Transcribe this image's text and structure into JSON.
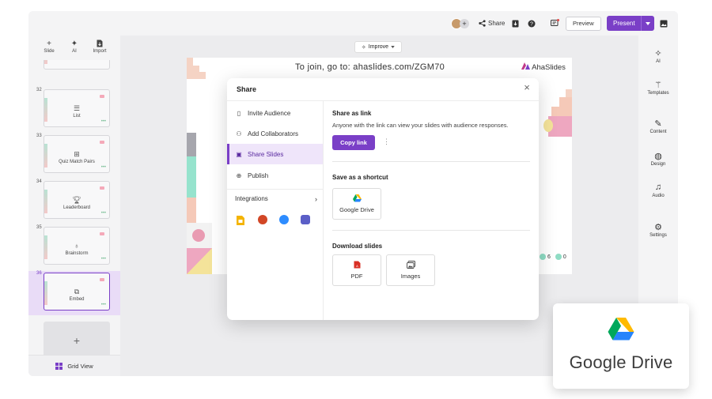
{
  "topbar": {
    "share_label": "Share",
    "preview_label": "Preview",
    "present_label": "Present"
  },
  "left_toolbar": {
    "slide_label": "Slide",
    "ai_label": "AI",
    "import_label": "Import"
  },
  "slides": [
    {
      "number": "32",
      "label": "List",
      "icon": "list-icon"
    },
    {
      "number": "33",
      "label": "Quiz Match Pairs",
      "icon": "match-pairs-icon"
    },
    {
      "number": "34",
      "label": "Leaderboard",
      "icon": "trophy-icon"
    },
    {
      "number": "35",
      "label": "Brainstorm",
      "icon": "lightbulb-icon"
    },
    {
      "number": "36",
      "label": "Embed",
      "icon": "embed-icon",
      "active": true
    }
  ],
  "grid_view_label": "Grid View",
  "right_panel": [
    {
      "label": "AI",
      "icon": "sparkle-icon"
    },
    {
      "label": "Templates",
      "icon": "wand-icon"
    },
    {
      "label": "Content",
      "icon": "pencil-icon"
    },
    {
      "label": "Design",
      "icon": "palette-icon"
    },
    {
      "label": "Audio",
      "icon": "music-icon"
    },
    {
      "label": "Settings",
      "icon": "gear-icon"
    }
  ],
  "improve_label": "Improve",
  "slide_canvas": {
    "join_text": "To join, go to: ahaslides.com/ZGM70",
    "logo_text": "AhaSlides",
    "reactions_count": "6",
    "participants_count": "0"
  },
  "modal": {
    "title": "Share",
    "nav": [
      {
        "label": "Invite Audience",
        "icon": "phone-icon"
      },
      {
        "label": "Add Collaborators",
        "icon": "users-icon"
      },
      {
        "label": "Share Slides",
        "icon": "slides-icon",
        "active": true
      },
      {
        "label": "Publish",
        "icon": "globe-icon"
      }
    ],
    "integrations_label": "Integrations",
    "share_link": {
      "title": "Share as link",
      "description": "Anyone with the link can view your slides with audience responses.",
      "copy_label": "Copy link"
    },
    "shortcut": {
      "title": "Save as a shortcut",
      "google_drive_label": "Google Drive"
    },
    "download": {
      "title": "Download slides",
      "pdf_label": "PDF",
      "images_label": "Images"
    }
  },
  "badge": {
    "text": "Google Drive"
  },
  "colors": {
    "accent": "#7a3fc7",
    "accent_light": "#efe5fa"
  }
}
